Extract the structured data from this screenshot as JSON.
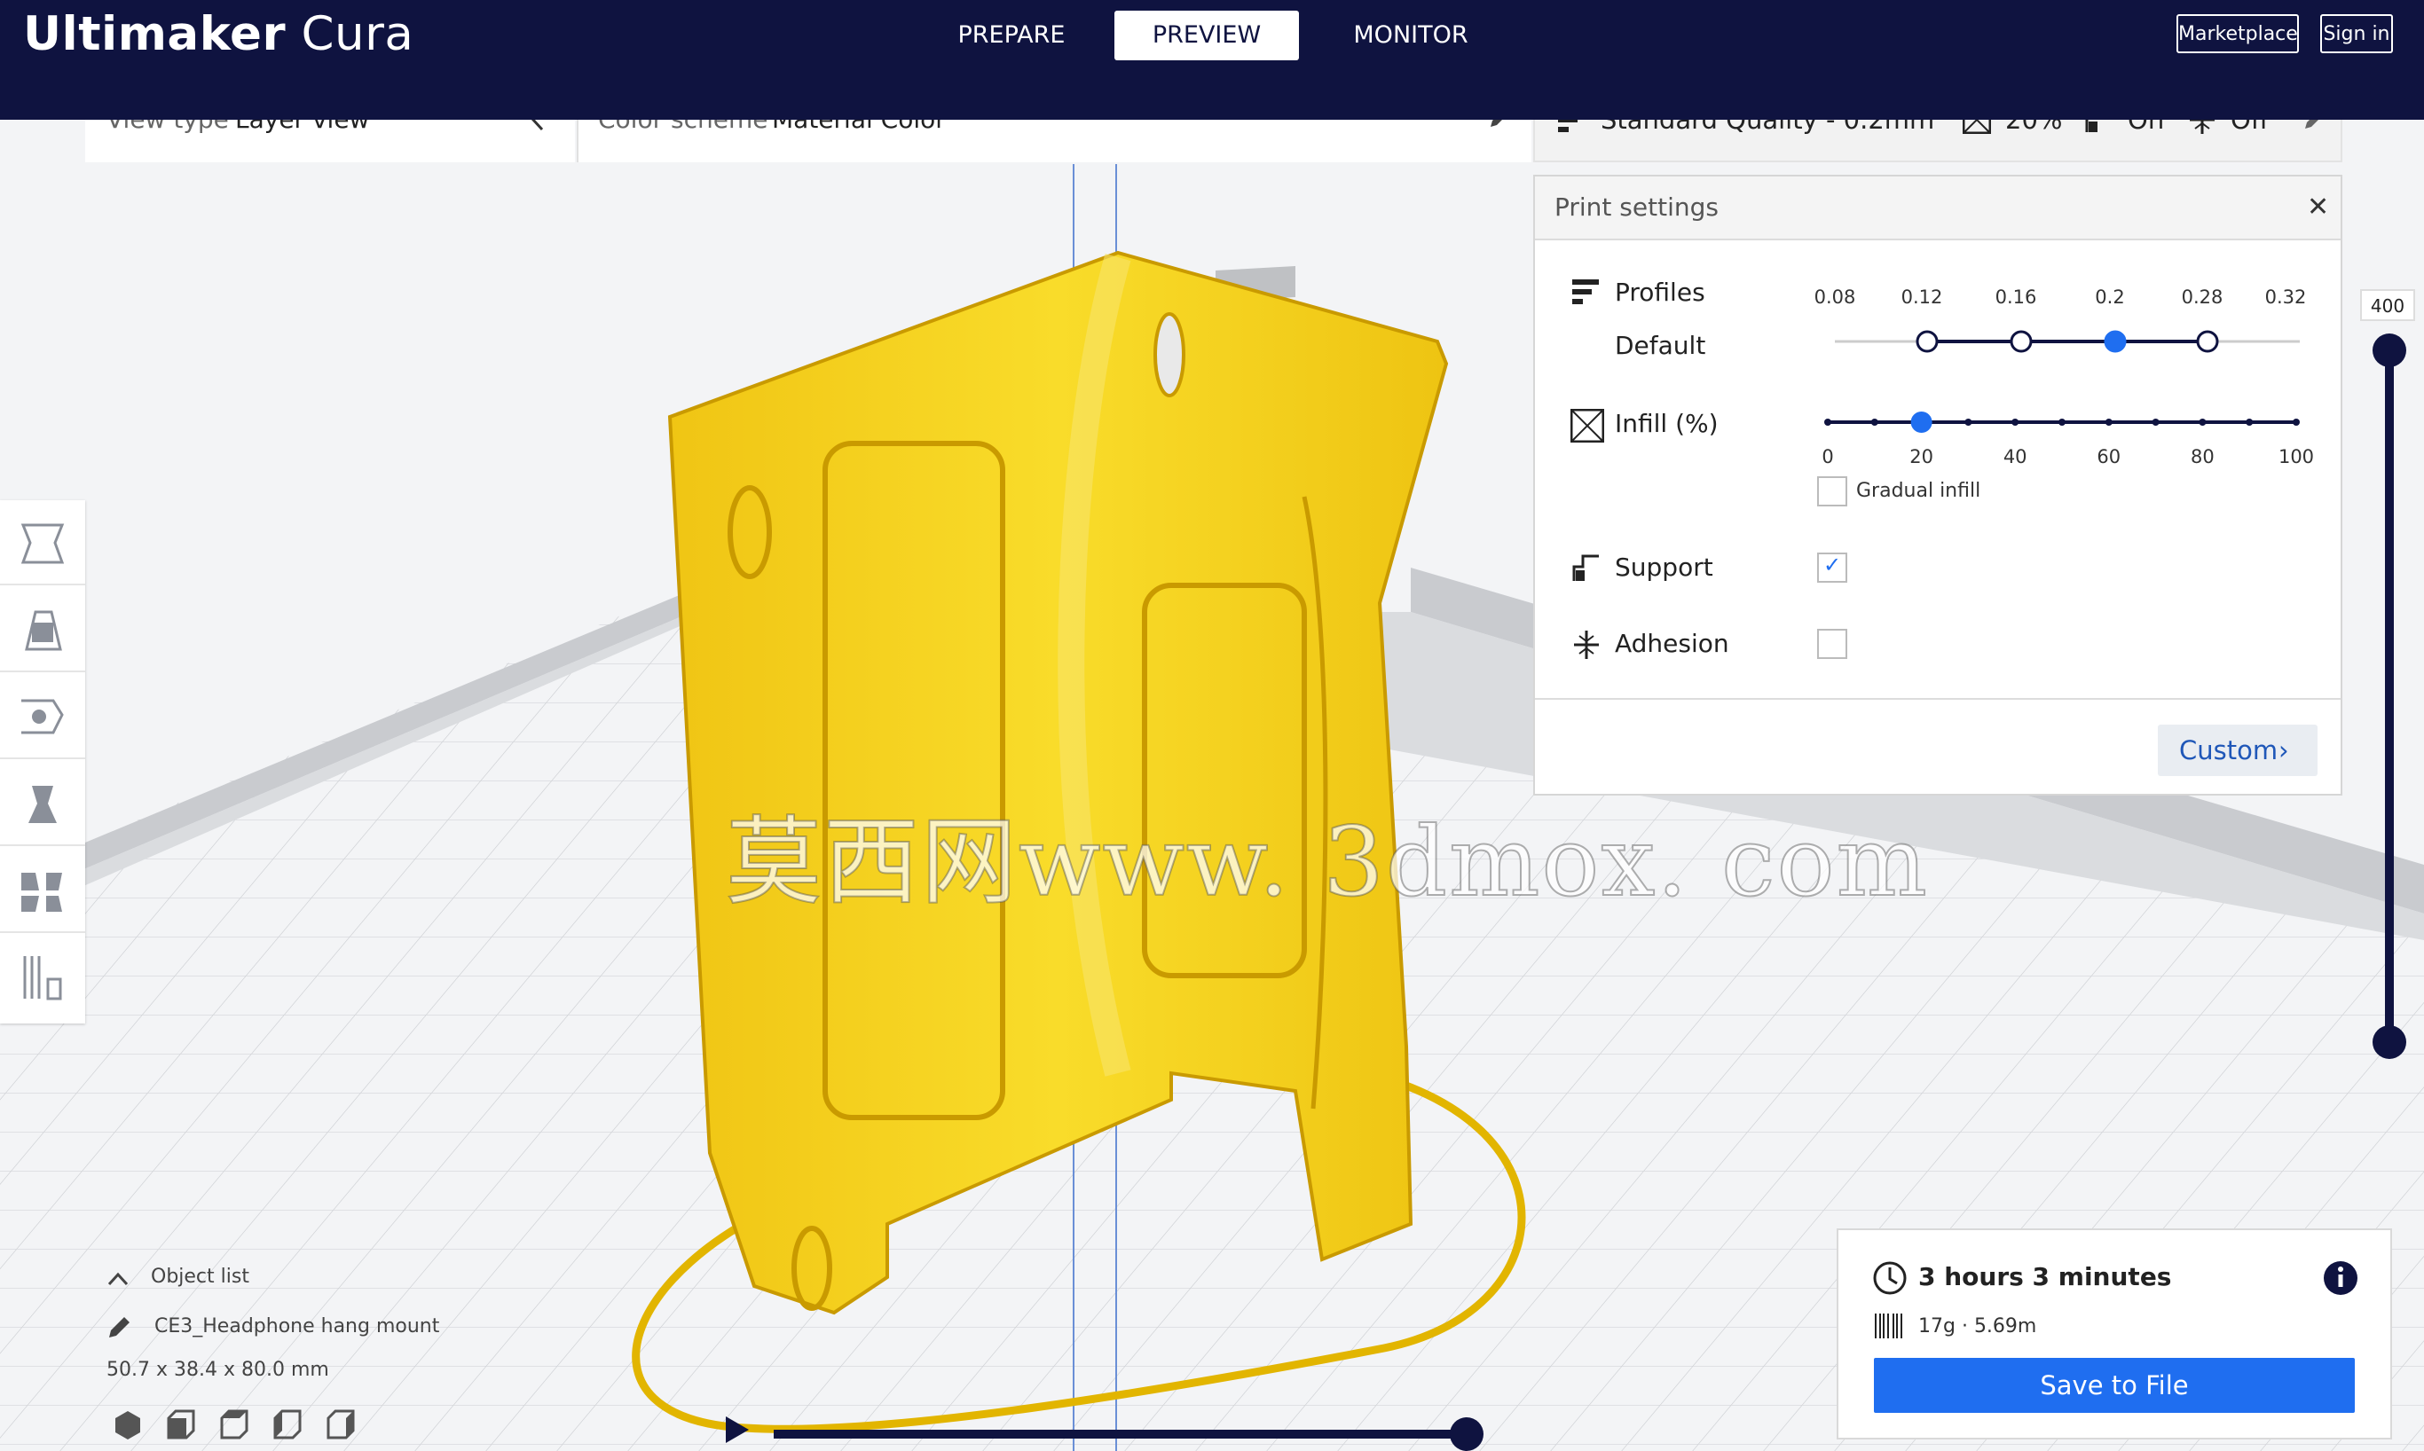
{
  "app": {
    "brand_bold": "Ultimaker",
    "brand_light": "Cura"
  },
  "stages": {
    "prepare": "PREPARE",
    "preview": "PREVIEW",
    "monitor": "MONITOR"
  },
  "header_buttons": {
    "marketplace": "Marketplace",
    "sign_in": "Sign in"
  },
  "view_toolbar": {
    "view_type_label": "View type",
    "view_type_value": "Layer view",
    "color_scheme_label": "Color scheme",
    "color_scheme_value": "Material Color"
  },
  "settings_summary": {
    "profile": "Standard Quality - 0.2mm",
    "infill": "20%",
    "support": "On",
    "adhesion": "Off"
  },
  "print_settings": {
    "title": "Print settings",
    "profiles_label": "Profiles",
    "profiles_sub": "Default",
    "layer_heights": [
      "0.08",
      "0.12",
      "0.16",
      "0.2",
      "0.28",
      "0.32"
    ],
    "selected_layer_height": "0.2",
    "infill_label": "Infill (%)",
    "infill_ticks": [
      "0",
      "20",
      "40",
      "60",
      "80",
      "100"
    ],
    "infill_value": 20,
    "gradual_infill_label": "Gradual infill",
    "gradual_infill_checked": false,
    "support_label": "Support",
    "support_checked": true,
    "adhesion_label": "Adhesion",
    "adhesion_checked": false,
    "custom_button": "Custom"
  },
  "layer_slider": {
    "current_layer": "400"
  },
  "object_list": {
    "header": "Object list",
    "object_name": "CE3_Headphone hang mount",
    "dimensions": "50.7 x 38.4 x 80.0 mm"
  },
  "estimate": {
    "time": "3 hours 3 minutes",
    "material": "17g · 5.69m",
    "save_button": "Save to File"
  },
  "watermark": "莫西网www. 3dmox. com",
  "colors": {
    "header_bg": "#0f1340",
    "accent": "#1f6ef0",
    "model_yellow": "#f6d21c"
  }
}
